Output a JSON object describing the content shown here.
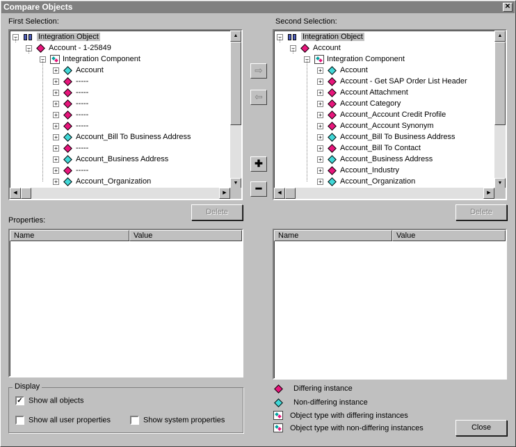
{
  "window": {
    "title": "Compare Objects"
  },
  "first": {
    "label": "First Selection:",
    "root": "Integration Object",
    "level1": "Account - 1-25849",
    "level2": "Integration Component",
    "items": [
      {
        "text": "Account",
        "type": "same"
      },
      {
        "text": "-----",
        "type": "diff"
      },
      {
        "text": "-----",
        "type": "diff"
      },
      {
        "text": "-----",
        "type": "diff"
      },
      {
        "text": "-----",
        "type": "diff"
      },
      {
        "text": "-----",
        "type": "diff"
      },
      {
        "text": "Account_Bill To Business Address",
        "type": "same"
      },
      {
        "text": "-----",
        "type": "diff"
      },
      {
        "text": "Account_Business Address",
        "type": "same"
      },
      {
        "text": "-----",
        "type": "diff"
      },
      {
        "text": "Account_Organization",
        "type": "same"
      }
    ],
    "delete": "Delete"
  },
  "second": {
    "label": "Second Selection:",
    "root": "Integration Object",
    "level1": "Account",
    "level2": "Integration Component",
    "items": [
      {
        "text": "Account",
        "type": "same"
      },
      {
        "text": "Account - Get SAP Order List Header",
        "type": "diff"
      },
      {
        "text": "Account Attachment",
        "type": "diff"
      },
      {
        "text": "Account Category",
        "type": "diff"
      },
      {
        "text": "Account_Account Credit Profile",
        "type": "diff"
      },
      {
        "text": "Account_Account Synonym",
        "type": "diff"
      },
      {
        "text": "Account_Bill To Business Address",
        "type": "same"
      },
      {
        "text": "Account_Bill To Contact",
        "type": "diff"
      },
      {
        "text": "Account_Business Address",
        "type": "same"
      },
      {
        "text": "Account_Industry",
        "type": "diff"
      },
      {
        "text": "Account_Organization",
        "type": "same"
      }
    ],
    "delete": "Delete"
  },
  "properties": {
    "label": "Properties:",
    "col_name": "Name",
    "col_value": "Value"
  },
  "display": {
    "label": "Display",
    "show_all_objects": "Show all objects",
    "show_all_user_properties": "Show all user properties",
    "show_system_properties": "Show system properties",
    "show_all_objects_checked": true
  },
  "legend": {
    "differing": "Differing instance",
    "non_differing": "Non-differing instance",
    "type_differing": "Object type with differing instances",
    "type_non_differing": "Object type with non-differing instances"
  },
  "close": "Close",
  "colors": {
    "differing": "#e8157c",
    "non_differing": "#40d8d8",
    "titlebar": "#808080",
    "face": "#c0c0c0"
  }
}
